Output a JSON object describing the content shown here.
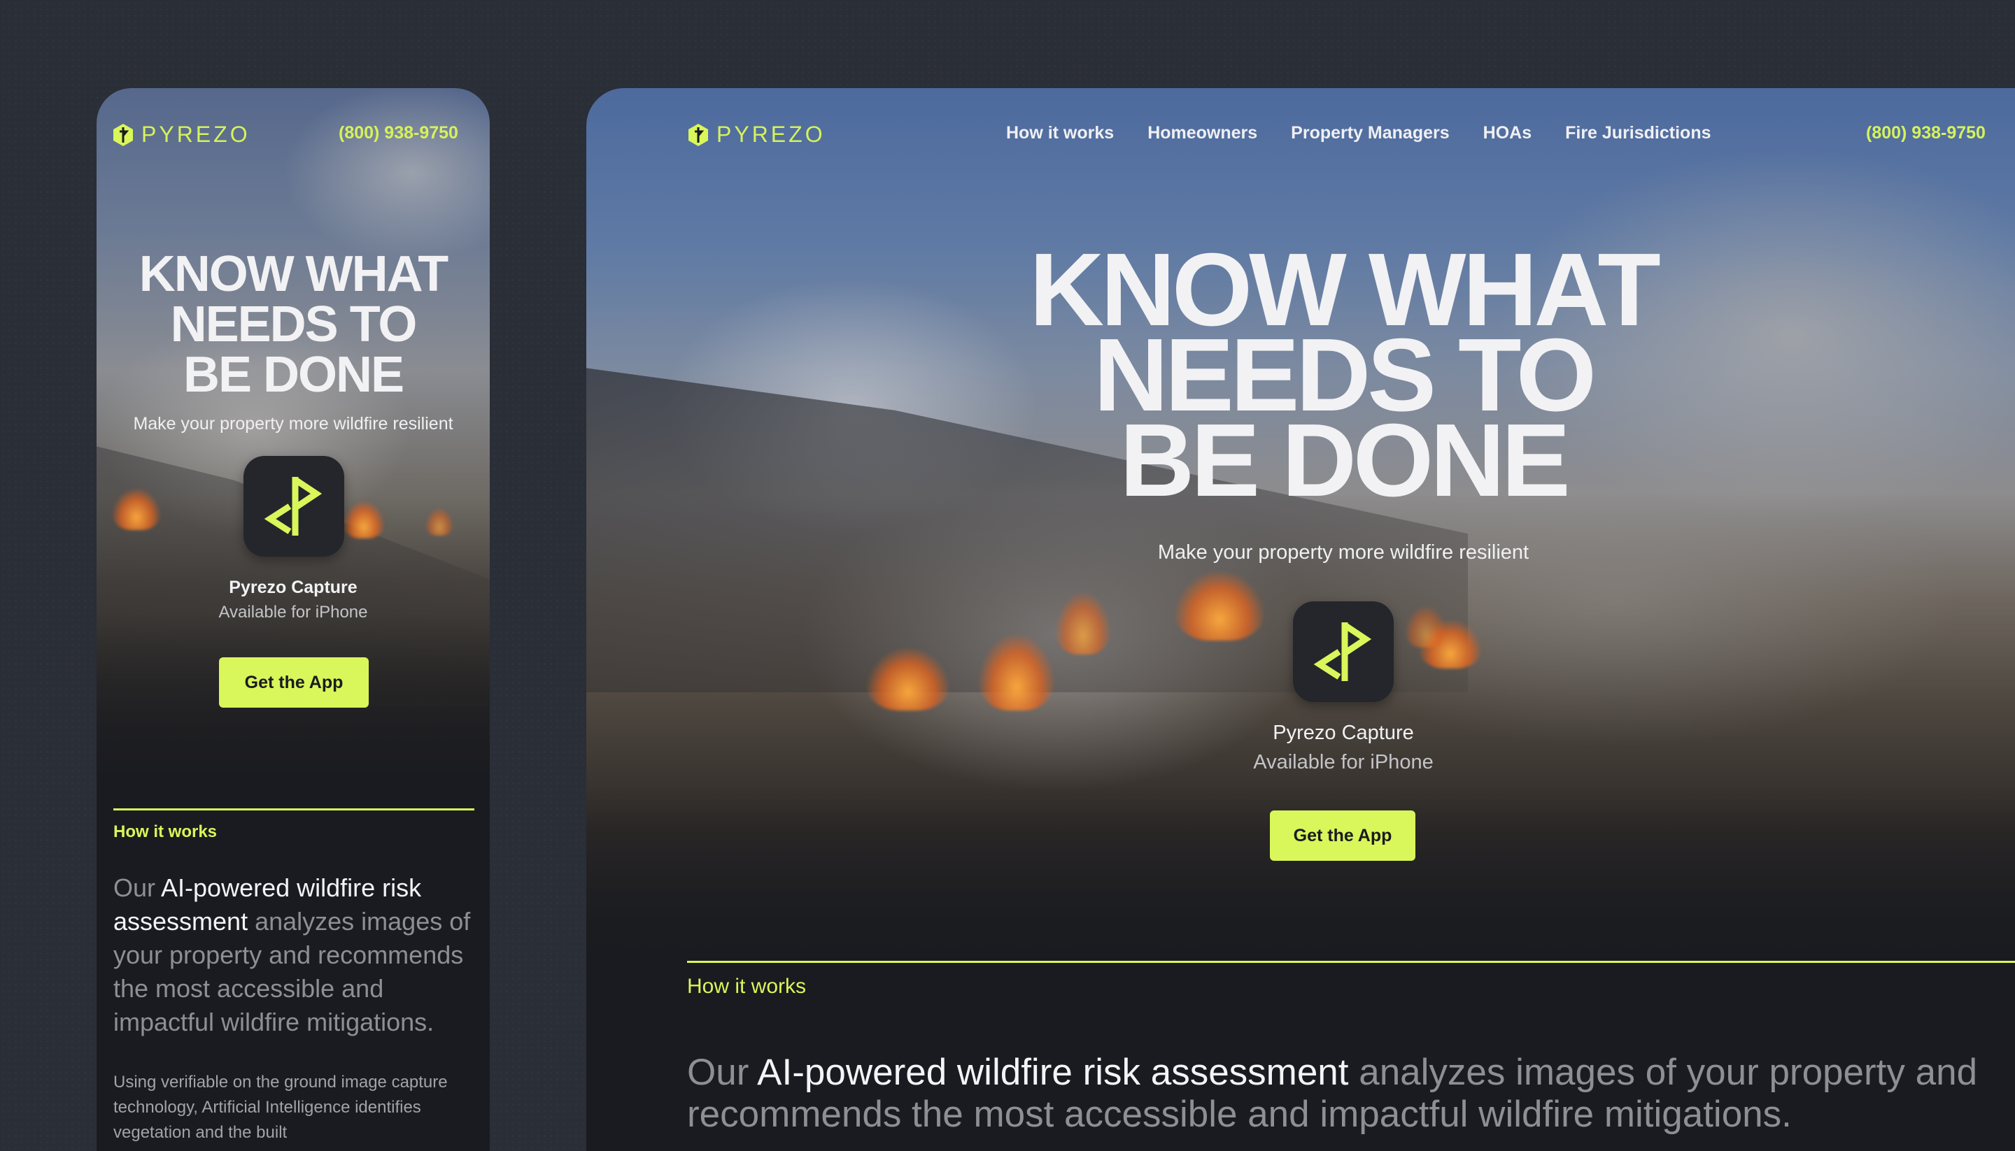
{
  "brand": {
    "name": "PYREZO",
    "accent": "#d9f65a"
  },
  "contact": {
    "phone": "(800) 938-9750"
  },
  "nav": {
    "items": [
      "How it works",
      "Homeowners",
      "Property Managers",
      "HOAs",
      "Fire Jurisdictions"
    ]
  },
  "hero": {
    "headline_lines": [
      "KNOW WHAT",
      "NEEDS TO",
      "BE DONE"
    ],
    "subtitle": "Make your property more wildfire resilient",
    "app_name": "Pyrezo Capture",
    "app_availability": "Available for iPhone",
    "cta": "Get the App"
  },
  "how_it_works": {
    "label": "How it works",
    "lede_lead": "Our ",
    "lede_highlight": "AI-powered wildfire risk assessment",
    "lede_rest": " analyzes images of your property and recommends the most accessible and impactful wildfire mitigations.",
    "body": "Using verifiable on the ground image capture technology, Artificial Intelligence identifies vegetation and the built"
  }
}
